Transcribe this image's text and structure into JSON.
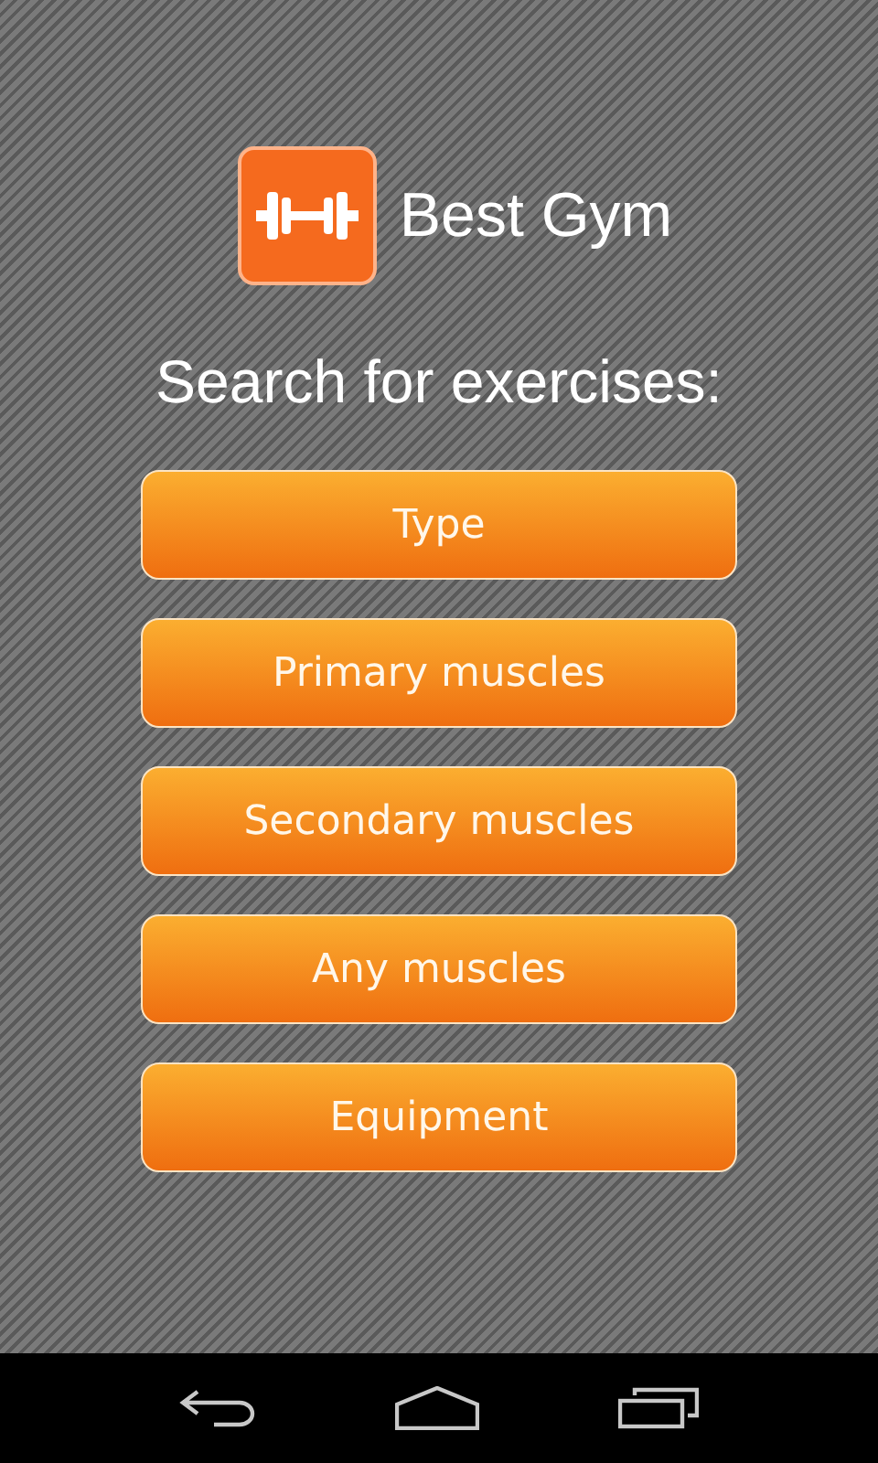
{
  "app": {
    "title": "Best Gym"
  },
  "heading": "Search for exercises:",
  "buttons": [
    "Type",
    "Primary muscles",
    "Secondary muscles",
    "Any muscles",
    "Equipment"
  ]
}
